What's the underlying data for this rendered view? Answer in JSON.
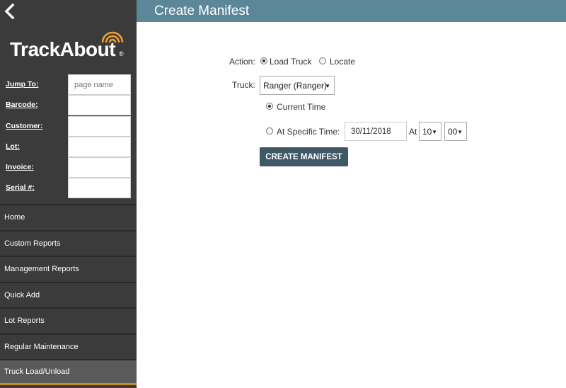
{
  "sidebar": {
    "back_icon": "chevron-left-icon",
    "logo_text": "TrackAbout",
    "logo_reg": "®",
    "jump_fields": [
      {
        "label": "Jump To:",
        "placeholder": "page name",
        "value": ""
      },
      {
        "label": "Barcode:",
        "placeholder": "",
        "value": ""
      },
      {
        "label": "Customer:",
        "placeholder": "",
        "value": ""
      },
      {
        "label": "Lot:",
        "placeholder": "",
        "value": ""
      },
      {
        "label": "Invoice:",
        "placeholder": "",
        "value": ""
      },
      {
        "label": "Serial #:",
        "placeholder": "",
        "value": ""
      }
    ],
    "nav": [
      {
        "label": "Home"
      },
      {
        "label": "Custom Reports"
      },
      {
        "label": "Management Reports"
      },
      {
        "label": "Quick Add"
      },
      {
        "label": "Lot Reports"
      },
      {
        "label": "Regular Maintenance"
      },
      {
        "label": "Truck Load/Unload",
        "active": true
      }
    ]
  },
  "header": {
    "title": "Create Manifest"
  },
  "form": {
    "action_label": "Action:",
    "action_options": [
      {
        "label": "Load Truck",
        "checked": true
      },
      {
        "label": "Locate",
        "checked": false
      }
    ],
    "truck_label": "Truck:",
    "truck_value": "Ranger (Ranger)",
    "time_options": [
      {
        "label": "Current Time",
        "checked": true
      },
      {
        "label": "At Specific Time:",
        "checked": false
      }
    ],
    "date_value": "30/11/2018",
    "at_label": "At",
    "hour_value": "10",
    "minute_value": "00",
    "submit_label": "CREATE MANIFEST"
  },
  "colors": {
    "sidebar_bg": "#3b3b3b",
    "header_bg": "#5c8799",
    "button_bg": "#3f5866",
    "active_accent": "#c58b2a",
    "logo_arc": "#f0a030"
  }
}
